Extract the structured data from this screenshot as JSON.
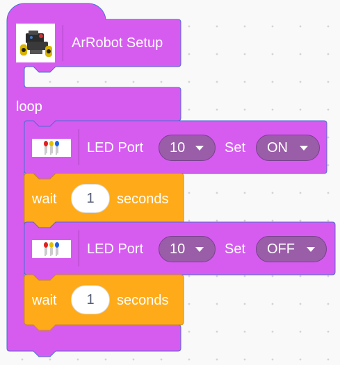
{
  "setup_block": {
    "label": "ArRobot Setup",
    "icon": "robot-car-icon"
  },
  "loop_block": {
    "label": "loop"
  },
  "led_block_1": {
    "label": "LED Port",
    "port": "10",
    "set_label": "Set",
    "state": "ON",
    "icon": "led-lights-icon"
  },
  "wait_block_1": {
    "label": "wait",
    "value": "1",
    "unit": "seconds"
  },
  "led_block_2": {
    "label": "LED Port",
    "port": "10",
    "set_label": "Set",
    "state": "OFF",
    "icon": "led-lights-icon"
  },
  "wait_block_2": {
    "label": "wait",
    "value": "1",
    "unit": "seconds"
  },
  "colors": {
    "block_purple": "#d65cf0",
    "block_border": "#4a6cd4",
    "dropdown_fill": "#9a5ea8",
    "wait_orange": "#ffab19",
    "wait_border": "#cf8b17"
  }
}
